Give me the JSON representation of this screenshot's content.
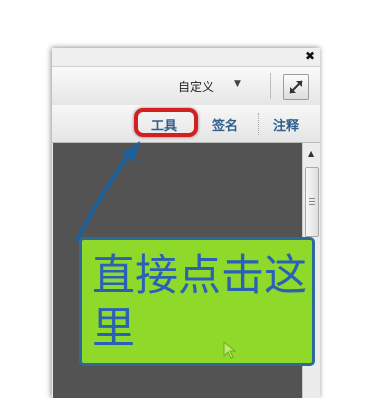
{
  "window": {
    "close_icon": "close-icon"
  },
  "toolbar": {
    "customize_label": "自定义",
    "dropdown_icon": "caret-down-icon",
    "expand_icon": "expand-icon"
  },
  "tabs": [
    {
      "label": "工具",
      "highlighted": true
    },
    {
      "label": "签名"
    },
    {
      "label": "注释"
    }
  ],
  "annotation": {
    "text": "直接点击这里",
    "arrow_color": "#1d5f9b",
    "highlight_color": "#d21f1f",
    "callout_color": "#8fd92a"
  }
}
